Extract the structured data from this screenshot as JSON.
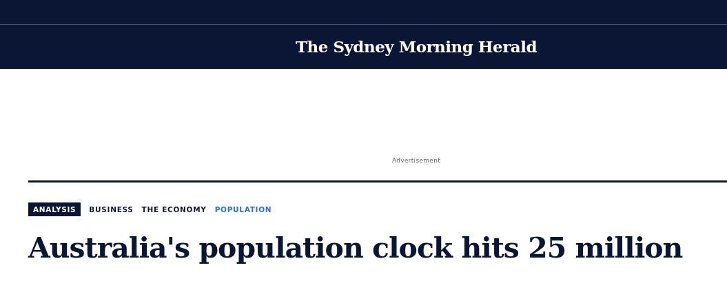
{
  "masthead": {
    "title": "The Sydney Morning Herald"
  },
  "advertisement": {
    "label": "Advertisement"
  },
  "tags": [
    {
      "label": "ANALYSIS",
      "kind": "label"
    },
    {
      "label": "BUSINESS",
      "kind": "link"
    },
    {
      "label": "THE ECONOMY",
      "kind": "link"
    },
    {
      "label": "POPULATION",
      "kind": "current"
    }
  ],
  "headline": "Australia's population clock hits 25 million"
}
